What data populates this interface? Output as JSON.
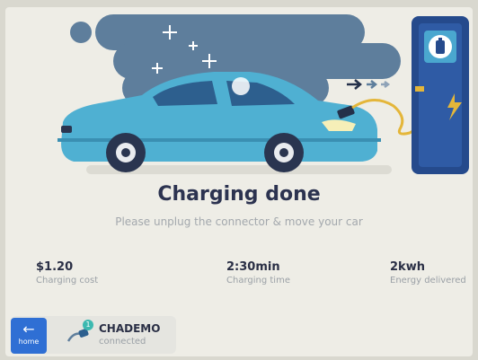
{
  "colors": {
    "car_body": "#4fb0d2",
    "station": "#254a8c",
    "cable": "#e4b63a",
    "accent": "#2f6fd4"
  },
  "status": {
    "title": "Charging done",
    "subtitle": "Please unplug the connector & move your car"
  },
  "stats": [
    {
      "value": "$1.20",
      "label": "Charging cost"
    },
    {
      "value": "2:30min",
      "label": "Charging time"
    },
    {
      "value": "2kwh",
      "label": "Energy delivered"
    }
  ],
  "nav": {
    "home_label": "home",
    "home_icon": "arrow-left-icon"
  },
  "connector": {
    "badge": "1",
    "name": "CHADEMO",
    "status": "connected",
    "icon": "plug-icon"
  },
  "illustration": {
    "station_icon": "battery-icon",
    "bolt_icon": "lightning-bolt-icon"
  }
}
